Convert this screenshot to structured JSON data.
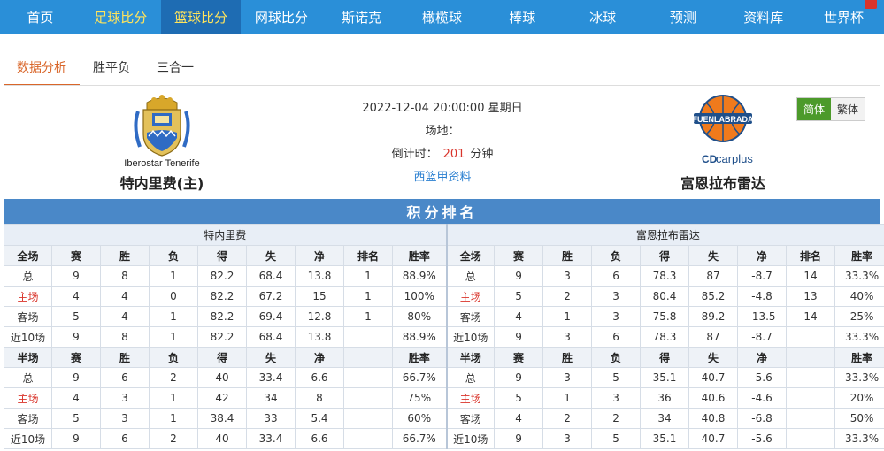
{
  "nav": {
    "items": [
      {
        "label": "首页",
        "style": "normal"
      },
      {
        "label": "足球比分",
        "style": "hl"
      },
      {
        "label": "篮球比分",
        "style": "active"
      },
      {
        "label": "网球比分",
        "style": "normal"
      },
      {
        "label": "斯诺克",
        "style": "normal"
      },
      {
        "label": "橄榄球",
        "style": "normal"
      },
      {
        "label": "棒球",
        "style": "normal"
      },
      {
        "label": "冰球",
        "style": "normal"
      },
      {
        "label": "预测",
        "style": "normal"
      },
      {
        "label": "资料库",
        "style": "normal"
      },
      {
        "label": "世界杯",
        "style": "normal"
      }
    ]
  },
  "subtabs": [
    "数据分析",
    "胜平负",
    "三合一"
  ],
  "match": {
    "datetime": "2022-12-04 20:00:00 星期日",
    "venue_label": "场地：",
    "countdown_label": "倒计时：",
    "countdown_value": "201",
    "countdown_unit": "分钟",
    "league_link": "西篮甲资料",
    "home": {
      "name": "特内里费(主)",
      "logo_text": "Iberostar Tenerife"
    },
    "away": {
      "name": "富恩拉布雷达",
      "logo_text": "FUENLABRADA",
      "sponsor": "carplus",
      "sponsor_mark": "CD"
    }
  },
  "lang": {
    "simplified": "简体",
    "traditional": "繁体"
  },
  "colors": {
    "nav_bg": "#2a8fd8",
    "nav_active": "#1e6cb3",
    "accent_yellow": "#ffe45c",
    "red": "#d9342b",
    "table_title": "#4a88c8"
  },
  "standings": {
    "title": "积分排名",
    "home_team": "特内里费",
    "away_team": "富恩拉布雷达",
    "full_headers": [
      "全场",
      "赛",
      "胜",
      "负",
      "得",
      "失",
      "净",
      "排名",
      "胜率"
    ],
    "half_headers": [
      "半场",
      "赛",
      "胜",
      "负",
      "得",
      "失",
      "净",
      "",
      "胜率"
    ],
    "full": {
      "home": [
        [
          "总",
          "9",
          "8",
          "1",
          "82.2",
          "68.4",
          "13.8",
          "1",
          "88.9%"
        ],
        [
          "主场",
          "4",
          "4",
          "0",
          "82.2",
          "67.2",
          "15",
          "1",
          "100%"
        ],
        [
          "客场",
          "5",
          "4",
          "1",
          "82.2",
          "69.4",
          "12.8",
          "1",
          "80%"
        ],
        [
          "近10场",
          "9",
          "8",
          "1",
          "82.2",
          "68.4",
          "13.8",
          "",
          "88.9%"
        ]
      ],
      "away": [
        [
          "总",
          "9",
          "3",
          "6",
          "78.3",
          "87",
          "-8.7",
          "14",
          "33.3%"
        ],
        [
          "主场",
          "5",
          "2",
          "3",
          "80.4",
          "85.2",
          "-4.8",
          "13",
          "40%"
        ],
        [
          "客场",
          "4",
          "1",
          "3",
          "75.8",
          "89.2",
          "-13.5",
          "14",
          "25%"
        ],
        [
          "近10场",
          "9",
          "3",
          "6",
          "78.3",
          "87",
          "-8.7",
          "",
          "33.3%"
        ]
      ]
    },
    "half": {
      "home": [
        [
          "总",
          "9",
          "6",
          "2",
          "40",
          "33.4",
          "6.6",
          "",
          "66.7%"
        ],
        [
          "主场",
          "4",
          "3",
          "1",
          "42",
          "34",
          "8",
          "",
          "75%"
        ],
        [
          "客场",
          "5",
          "3",
          "1",
          "38.4",
          "33",
          "5.4",
          "",
          "60%"
        ],
        [
          "近10场",
          "9",
          "6",
          "2",
          "40",
          "33.4",
          "6.6",
          "",
          "66.7%"
        ]
      ],
      "away": [
        [
          "总",
          "9",
          "3",
          "5",
          "35.1",
          "40.7",
          "-5.6",
          "",
          "33.3%"
        ],
        [
          "主场",
          "5",
          "1",
          "3",
          "36",
          "40.6",
          "-4.6",
          "",
          "20%"
        ],
        [
          "客场",
          "4",
          "2",
          "2",
          "34",
          "40.8",
          "-6.8",
          "",
          "50%"
        ],
        [
          "近10场",
          "9",
          "3",
          "5",
          "35.1",
          "40.7",
          "-5.6",
          "",
          "33.3%"
        ]
      ]
    }
  }
}
